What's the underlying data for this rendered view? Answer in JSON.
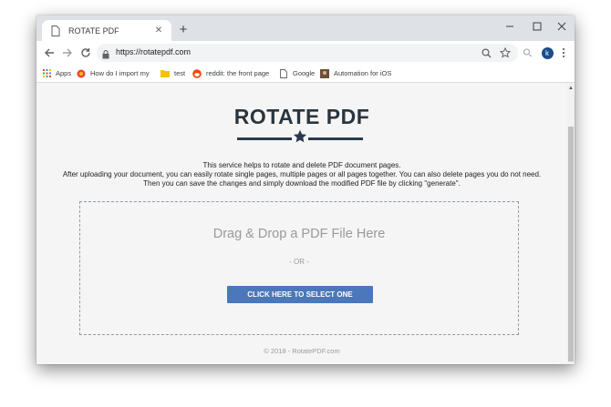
{
  "browser": {
    "tab_title": "ROTATE PDF",
    "url": "https://rotatepdf.com",
    "avatar_letter": "k"
  },
  "bookmarks": [
    {
      "label": "Apps",
      "icon": "apps-grid-icon"
    },
    {
      "label": "How do I import my",
      "icon": "site-favicon-icon"
    },
    {
      "label": "test",
      "icon": "folder-icon"
    },
    {
      "label": "reddit: the front page",
      "icon": "reddit-icon"
    },
    {
      "label": "Google",
      "icon": "page-icon"
    },
    {
      "label": "Automation for iOS",
      "icon": "site-favicon-icon"
    }
  ],
  "page": {
    "heading": "ROTATE PDF",
    "description": [
      "This service helps to rotate and delete PDF document pages.",
      "After uploading your document, you can easily rotate single pages, multiple pages or all pages together. You can also delete pages you do not need.",
      "Then you can save the changes and simply download the modified PDF file by clicking \"generate\"."
    ],
    "drop_title": "Drag & Drop a PDF File Here",
    "drop_or": "- OR -",
    "select_button": "CLICK HERE TO SELECT ONE",
    "footer": "© 2018 - RotatePDF.com"
  },
  "colors": {
    "heading": "#2a3540",
    "button": "#4a78bb",
    "page_bg": "#f5f5f5"
  }
}
